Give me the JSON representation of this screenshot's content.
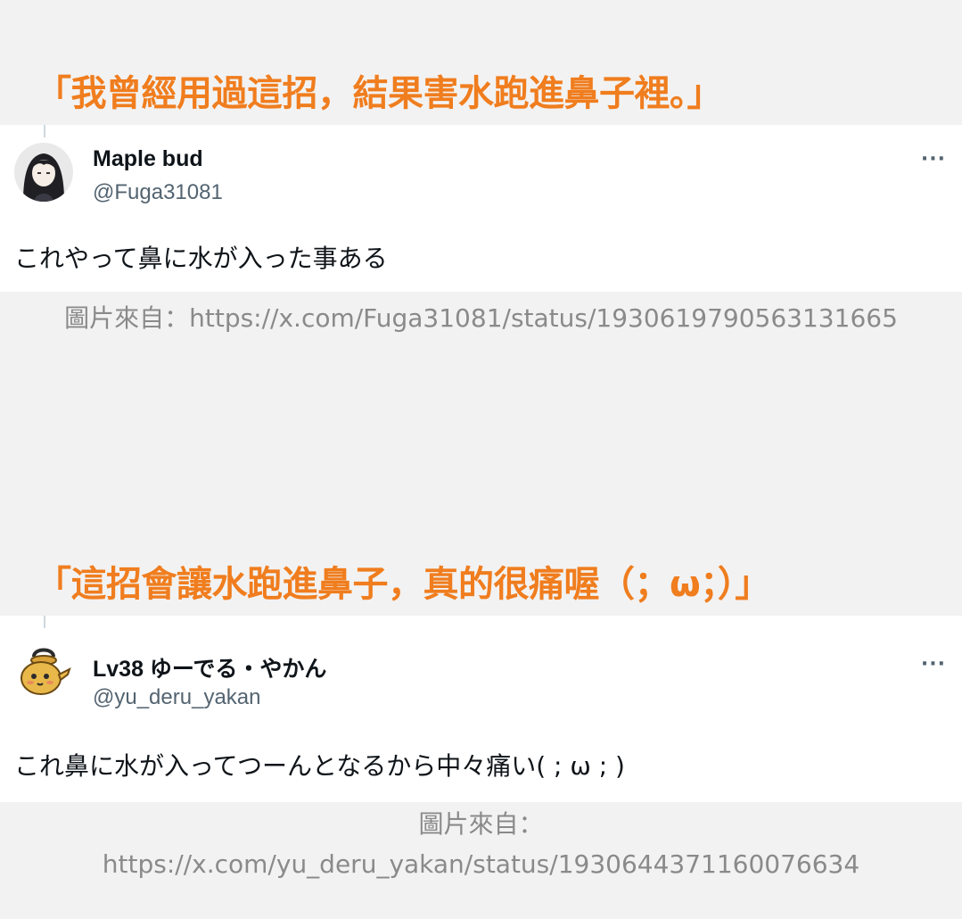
{
  "quotes": {
    "first": "「我曾經用過這招，結果害水跑進鼻子裡。」",
    "second": "「這招會讓水跑進鼻子，真的很痛喔（；ω；）」"
  },
  "tweets": [
    {
      "display_name": "Maple bud",
      "handle": "@Fuga31081",
      "text": "これやって鼻に水が入った事ある",
      "more_label": "···",
      "avatar_icon": "anime-girl-avatar-icon"
    },
    {
      "display_name": "Lv38 ゆーでる・やかん",
      "handle": "@yu_deru_yakan",
      "text": "これ鼻に水が入ってつーんとなるから中々痛い( ; ω ; )",
      "more_label": "···",
      "avatar_icon": "kettle-character-avatar-icon"
    }
  ],
  "credits": {
    "first": "圖片來自：https://x.com/Fuga31081/status/1930619790563131665",
    "second_label": "圖片來自：",
    "second_url": "https://x.com/yu_deru_yakan/status/1930644371160076634"
  },
  "colors": {
    "quote_orange": "#f07d1e",
    "background": "#f2f2f2",
    "card": "#ffffff",
    "credit_gray": "#8a8a8a"
  }
}
